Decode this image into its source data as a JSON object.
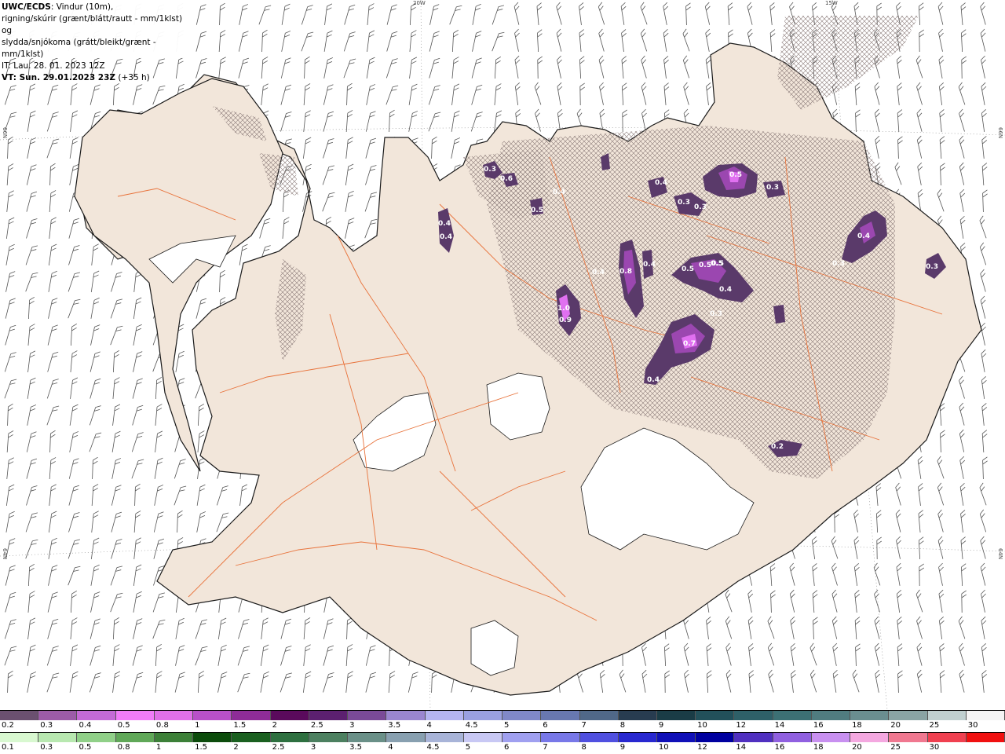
{
  "title": {
    "model": "UWC/ECDS",
    "line1_rest": ": Vindur (10m),",
    "line2": "rigning/skúrir (grænt/blátt/rautt - mm/1klst) og",
    "line3": "slydda/snjókoma (grátt/bleikt/grænt - mm/1klst)",
    "it": "IT: Lau. 28. 01. 2023 12Z",
    "vt_bold": "VT: Sun. 29.01.2023 23Z",
    "vt_rest": " (+35 h)"
  },
  "coords": {
    "top_20w": "20W",
    "top_15w": "15W",
    "left_66n": "66N",
    "right_66n": "66N",
    "left_64n": "64N",
    "right_64n": "64N"
  },
  "colors": {
    "land": "#f2e6da",
    "coast": "#1a1a1a",
    "roads": "#e8723a",
    "glacier": "#ffffff",
    "precip_dark": "#5a3a6a",
    "precip_mid": "#9b47b0",
    "precip_light": "#e070f0"
  },
  "precip_labels": [
    "0.3",
    "0.6",
    "0.4",
    "0.4",
    "0.5",
    "0.4",
    "0.5",
    "0.3",
    "0.3",
    "0.3",
    "0.4",
    "0.4",
    "0.3",
    "0.3",
    "0.8",
    "0.4",
    "1.0",
    "0.9",
    "0.5",
    "0.5",
    "0.5",
    "0.4",
    "0.3",
    "0.7",
    "0.4",
    "0.2",
    "0.4",
    "0.5"
  ],
  "legend_snow": {
    "colors": [
      "#6b5070",
      "#9c5ca8",
      "#c46ad6",
      "#f07cf8",
      "#e070e8",
      "#b850c8",
      "#8e2c98",
      "#5a0a5c",
      "#5c2070",
      "#7a4a98",
      "#9a86d0",
      "#b4b4f0",
      "#9aa0e0",
      "#8088c8",
      "#6878b0",
      "#506888",
      "#283c50",
      "#1a3c46",
      "#22505a",
      "#2e6068",
      "#3c7074",
      "#507c80",
      "#6a8e90",
      "#8aa4a4",
      "#c0d0d0",
      "#f4f4f4"
    ],
    "labels": [
      "0.2",
      "0.3",
      "0.4",
      "0.5",
      "0.8",
      "1",
      "1.5",
      "2",
      "2.5",
      "3",
      "3.5",
      "4",
      "4.5",
      "5",
      "6",
      "7",
      "8",
      "9",
      "10",
      "12",
      "14",
      "16",
      "18",
      "20",
      "25",
      "30"
    ]
  },
  "legend_rain": {
    "colors": [
      "#d8f8d0",
      "#b8e8b0",
      "#90d088",
      "#60a858",
      "#3c8038",
      "#0c4c0c",
      "#1a6020",
      "#2e7040",
      "#4c8060",
      "#6a9088",
      "#88a0b0",
      "#a8b4d8",
      "#c8c8f4",
      "#a0a0f0",
      "#7878e8",
      "#5050e0",
      "#2828d0",
      "#1010b8",
      "#0000a0",
      "#5030c0",
      "#9060e0",
      "#c890f0",
      "#f4a8e0",
      "#f07890",
      "#f04050",
      "#f01010"
    ],
    "labels": [
      "0.1",
      "0.3",
      "0.5",
      "0.8",
      "1",
      "1.5",
      "2",
      "2.5",
      "3",
      "3.5",
      "4",
      "4.5",
      "5",
      "6",
      "7",
      "8",
      "9",
      "10",
      "12",
      "14",
      "16",
      "18",
      "20",
      "25",
      "30",
      ""
    ]
  }
}
